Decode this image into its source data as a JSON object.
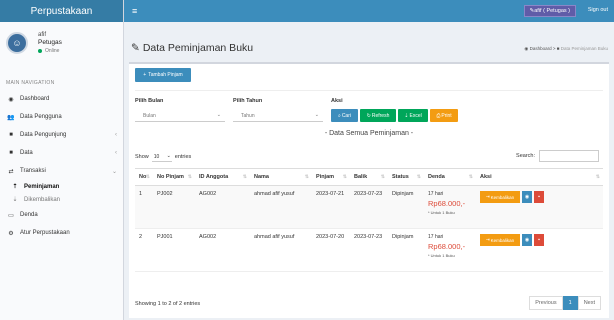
{
  "sidebar": {
    "brand": "Perpustakaan",
    "user_name": "afif",
    "user_role": "Petugas",
    "user_status": "Online",
    "nav_header": "MAIN NAVIGATION",
    "items": [
      {
        "label": "Dashboard",
        "icon": "dashboard-icon"
      },
      {
        "label": "Data Pengguna",
        "icon": "users-icon"
      },
      {
        "label": "Data Pengunjung",
        "icon": "visitor-icon"
      },
      {
        "label": "Data",
        "icon": "book-icon"
      },
      {
        "label": "Transaksi",
        "icon": "exchange-icon"
      },
      {
        "label": "Peminjaman",
        "icon": "upload-icon"
      },
      {
        "label": "Dikembalikan",
        "icon": "download-icon"
      },
      {
        "label": "Denda",
        "icon": "money-icon"
      },
      {
        "label": "Atur Perpustakaan",
        "icon": "cogs-icon"
      }
    ]
  },
  "topbar": {
    "user_button": "afif ( Petugas )",
    "signout": "Sign out"
  },
  "page": {
    "title": "Data Peminjaman Buku",
    "breadcrumb_home": "Dashboard",
    "breadcrumb_current": "Data Peminjaman Buku"
  },
  "filter": {
    "add_button": "Tambah Pinjam",
    "label_bulan": "Pilih Bulan",
    "label_tahun": "Pilih Tahun",
    "label_aksi": "Aksi",
    "bulan_value": "Bulan",
    "tahun_value": "Tahun",
    "btn_cari": "Cari",
    "btn_refresh": "Refresh",
    "btn_excel": "Excel",
    "btn_print": "Print"
  },
  "table_section": {
    "subtitle": "- Data Semua Peminjaman -",
    "show_label": "Show",
    "show_value": "10",
    "entries_label": "entries",
    "search_label": "Search:",
    "columns": [
      "No",
      "No Pinjam",
      "ID Anggota",
      "Nama",
      "Pinjam",
      "Balik",
      "Status",
      "Denda",
      "Aksi"
    ],
    "rows": [
      {
        "no": "1",
        "no_pinjam": "PJ002",
        "id_anggota": "AG002",
        "nama": "ahmad afif yusuf",
        "pinjam": "2023-07-21",
        "balik": "2023-07-23",
        "status": "Dipinjam",
        "denda_hari": "17 hari",
        "denda_rp": "Rp68.000,-",
        "denda_note": "* Untuk 1 Buku",
        "btn_kembali": "Kembalikan"
      },
      {
        "no": "2",
        "no_pinjam": "PJ001",
        "id_anggota": "AG002",
        "nama": "ahmad afif yusuf",
        "pinjam": "2023-07-20",
        "balik": "2023-07-23",
        "status": "Dipinjam",
        "denda_hari": "17 hari",
        "denda_rp": "Rp68.000,-",
        "denda_note": "* Untuk 1 Buku",
        "btn_kembali": "Kembalikan"
      }
    ],
    "info": "Showing 1 to 2 of 2 entries",
    "prev": "Previous",
    "page": "1",
    "next": "Next"
  },
  "colors": {
    "header": "#3c8dbc",
    "brand": "#357ca5",
    "danger": "#dd4b39",
    "success": "#00a65a",
    "warning": "#f39c12"
  }
}
